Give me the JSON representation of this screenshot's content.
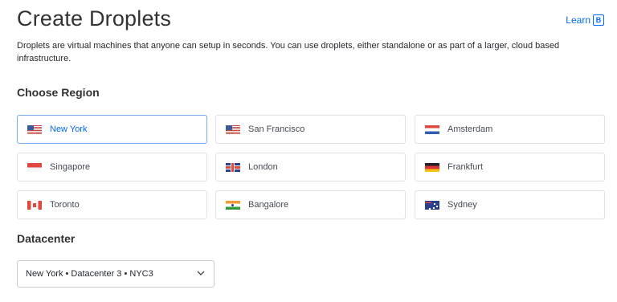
{
  "header": {
    "title": "Create Droplets",
    "learn_label": "Learn"
  },
  "description": "Droplets are virtual machines that anyone can setup in seconds. You can use droplets, either standalone or as part of a larger, cloud based infrastructure.",
  "region_section": {
    "heading": "Choose Region",
    "selected": "New York",
    "regions": [
      {
        "name": "New York",
        "flag": "us-flag-icon"
      },
      {
        "name": "San Francisco",
        "flag": "us-flag-icon"
      },
      {
        "name": "Amsterdam",
        "flag": "nl-flag-icon"
      },
      {
        "name": "Singapore",
        "flag": "sg-flag-icon"
      },
      {
        "name": "London",
        "flag": "gb-flag-icon"
      },
      {
        "name": "Frankfurt",
        "flag": "de-flag-icon"
      },
      {
        "name": "Toronto",
        "flag": "ca-flag-icon"
      },
      {
        "name": "Bangalore",
        "flag": "in-flag-icon"
      },
      {
        "name": "Sydney",
        "flag": "au-flag-icon"
      }
    ]
  },
  "datacenter_section": {
    "heading": "Datacenter",
    "selected_value": "New York • Datacenter 3 • NYC3"
  },
  "colors": {
    "accent": "#0069ff",
    "selected_border": "#77aaee",
    "card_border": "#dfe3e8"
  }
}
